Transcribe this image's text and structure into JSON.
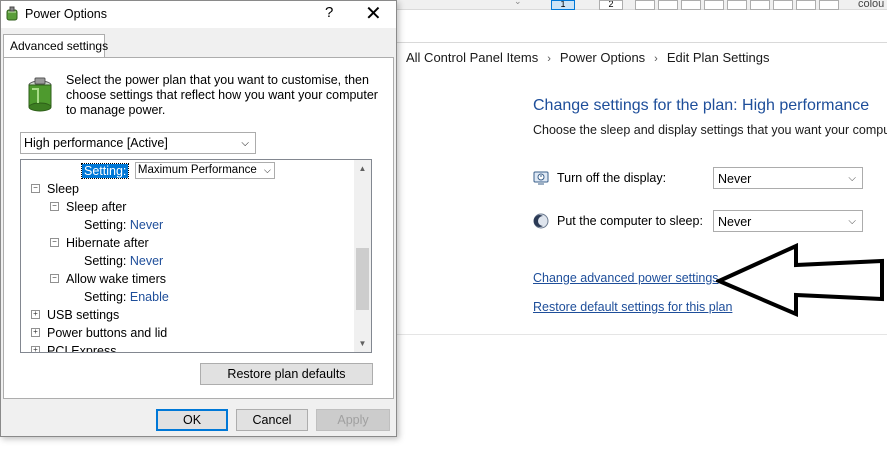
{
  "control_panel": {
    "pager": [
      "1",
      "2"
    ],
    "top_right_text": "colou",
    "breadcrumb": [
      "All Control Panel Items",
      "Power Options",
      "Edit Plan Settings"
    ],
    "title": "Change settings for the plan: High performance",
    "subtitle": "Choose the sleep and display settings that you want your computer",
    "display_label": "Turn off the display:",
    "display_value": "Never",
    "sleep_label": "Put the computer to sleep:",
    "sleep_value": "Never",
    "advanced_link": "Change advanced power settings",
    "restore_link": "Restore default settings for this plan"
  },
  "dialog": {
    "title": "Power Options",
    "help": "?",
    "close": "✕",
    "tab": "Advanced settings",
    "description": "Select the power plan that you want to customise, then choose settings that reflect how you want your computer to manage power.",
    "plan": "High performance [Active]",
    "tree": {
      "top_setting_label": "Setting:",
      "top_setting_value": "Maximum Performance",
      "sleep": "Sleep",
      "sleep_after": "Sleep after",
      "sleep_after_setting": "Setting:",
      "sleep_after_value": "Never",
      "hibernate_after": "Hibernate after",
      "hibernate_setting": "Setting:",
      "hibernate_value": "Never",
      "wake_timers": "Allow wake timers",
      "wake_setting": "Setting:",
      "wake_value": "Enable",
      "usb": "USB settings",
      "power_buttons": "Power buttons and lid",
      "pci": "PCI Express"
    },
    "restore_button": "Restore plan defaults",
    "ok": "OK",
    "cancel": "Cancel",
    "apply": "Apply"
  }
}
